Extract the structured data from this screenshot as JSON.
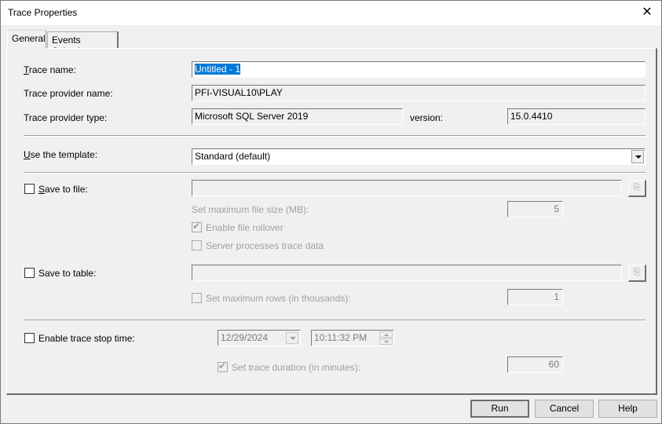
{
  "window": {
    "title": "Trace Properties"
  },
  "tabs": [
    {
      "label": "General",
      "active": true
    },
    {
      "label": "Events Selection",
      "active": false
    }
  ],
  "general": {
    "trace_name": {
      "label_prefix": "T",
      "label_rest": "race name:",
      "value": "Untitled - 1"
    },
    "provider_name": {
      "label": "Trace provider name:",
      "value": "PFI-VISUAL10\\PLAY"
    },
    "provider_type": {
      "label": "Trace provider type:",
      "value": "Microsoft SQL Server 2019",
      "version_label": "version:",
      "version_value": "15.0.4410"
    },
    "template": {
      "label_prefix": "U",
      "label_rest": "se the template:",
      "value": "Standard (default)"
    },
    "save_to_file": {
      "checked": false,
      "label_prefix": "S",
      "label_rest": "ave to file:",
      "value": "",
      "max_size_label": "Set maximum file size (MB):",
      "max_size_value": "5",
      "rollover": {
        "checked": true,
        "label": "Enable file rollover"
      },
      "server_processes": {
        "checked": false,
        "label": "Server processes trace data"
      }
    },
    "save_to_table": {
      "checked": false,
      "label": "Save to table:",
      "value": "",
      "max_rows": {
        "checked": false,
        "label": "Set maximum rows (in thousands):",
        "value": "1"
      }
    },
    "stop_time": {
      "checked": false,
      "label": "Enable trace stop time:",
      "date": "12/29/2024",
      "time": "10:11:32 PM",
      "duration": {
        "checked": true,
        "label": "Set trace duration (in minutes):",
        "value": "60"
      }
    }
  },
  "buttons": {
    "run": "Run",
    "cancel": "Cancel",
    "help": "Help"
  },
  "icons": {
    "close": "✕",
    "check": "✔",
    "browse": "⎘"
  }
}
